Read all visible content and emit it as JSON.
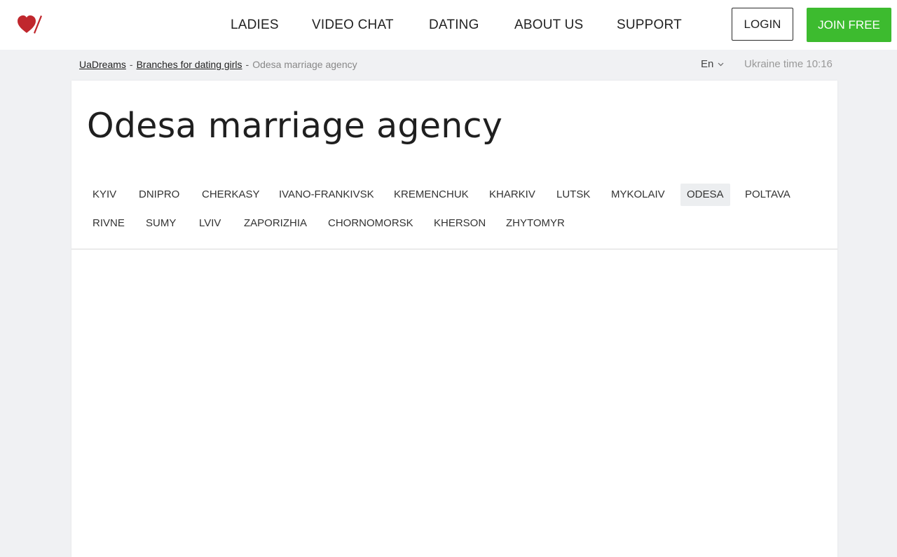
{
  "header": {
    "logo_icon": "heart-slash-logo",
    "brand_color": "#c0272d",
    "nav": [
      "LADIES",
      "VIDEO CHAT",
      "DATING",
      "ABOUT US",
      "SUPPORT"
    ],
    "login_label": "LOGIN",
    "join_label": "JOIN FREE",
    "join_color": "#3dbb2f"
  },
  "breadcrumb": {
    "items": [
      "UaDreams",
      "Branches for dating girls"
    ],
    "current": "Odesa marriage agency",
    "separator": "-"
  },
  "language": "En",
  "time_text": "Ukraine time 10:16",
  "page": {
    "title": "Odesa marriage agency"
  },
  "cities": {
    "row1": [
      "KYIV",
      "DNIPRO",
      "CHERKASY",
      "IVANO-FRANKIVSK",
      "KREMENCHUK",
      "KHARKIV",
      "LUTSK",
      "MYKOLAIV",
      "ODESA",
      "POLTAVA"
    ],
    "row2": [
      "RIVNE",
      "SUMY",
      "LVIV",
      "ZAPORIZHIA",
      "CHORNOMORSK",
      "KHERSON",
      "ZHYTOMYR"
    ],
    "active": "ODESA"
  }
}
